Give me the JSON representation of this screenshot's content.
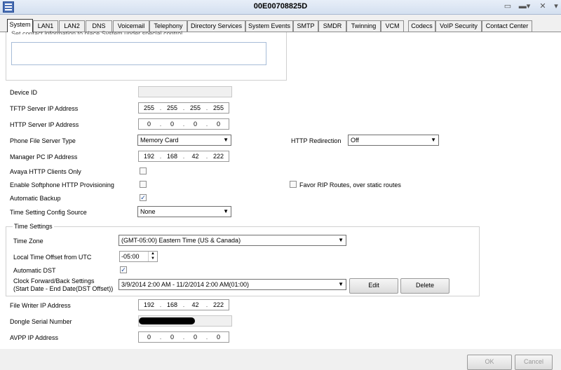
{
  "window": {
    "title": "00E00708825D"
  },
  "tabs": [
    {
      "label": "System"
    },
    {
      "label": "LAN1"
    },
    {
      "label": "LAN2"
    },
    {
      "label": "DNS"
    },
    {
      "label": "Voicemail"
    },
    {
      "label": "Telephony"
    },
    {
      "label": "Directory Services"
    },
    {
      "label": "System Events"
    },
    {
      "label": "SMTP"
    },
    {
      "label": "SMDR"
    },
    {
      "label": "Twinning"
    },
    {
      "label": "VCM"
    },
    {
      "label": "Codecs"
    },
    {
      "label": "VoIP Security"
    },
    {
      "label": "Contact Center"
    }
  ],
  "contact": {
    "partial_text": "Set contact information to place System under special control"
  },
  "fields": {
    "device_id": {
      "label": "Device ID",
      "value": ""
    },
    "tftp": {
      "label": "TFTP Server IP Address",
      "octets": [
        "255",
        "255",
        "255",
        "255"
      ]
    },
    "http_server": {
      "label": "HTTP Server IP Address",
      "octets": [
        "0",
        "0",
        "0",
        "0"
      ]
    },
    "phone_file_server": {
      "label": "Phone File Server Type",
      "value": "Memory Card"
    },
    "http_redirection": {
      "label": "HTTP Redirection",
      "value": "Off"
    },
    "manager_pc": {
      "label": "Manager PC IP Address",
      "octets": [
        "192",
        "168",
        "42",
        "222"
      ]
    },
    "avaya_http": {
      "label": "Avaya HTTP Clients Only"
    },
    "softphone_http": {
      "label": "Enable Softphone HTTP Provisioning"
    },
    "favor_rip": {
      "label": "Favor RIP Routes, over static routes"
    },
    "auto_backup": {
      "label": "Automatic Backup",
      "mark": "✓"
    },
    "time_source": {
      "label": "Time Setting Config Source",
      "value": "None"
    },
    "time_settings": {
      "legend": "Time Settings",
      "time_zone": {
        "label": "Time Zone",
        "value": "(GMT-05:00) Eastern Time (US & Canada)"
      },
      "offset": {
        "label": "Local Time Offset from UTC",
        "value": "-05:00"
      },
      "auto_dst": {
        "label": "Automatic DST",
        "mark": "✓"
      },
      "clock": {
        "label_line1": "Clock Forward/Back Settings",
        "label_line2": "(Start Date - End Date(DST Offset))",
        "value": "3/9/2014 2:00 AM - 11/2/2014 2:00 AM(01:00)",
        "edit": "Edit",
        "delete": "Delete"
      }
    },
    "file_writer": {
      "label": "File Writer IP Address",
      "octets": [
        "192",
        "168",
        "42",
        "222"
      ]
    },
    "dongle": {
      "label": "Dongle Serial Number"
    },
    "avpp": {
      "label": "AVPP IP Address",
      "octets": [
        "0",
        "0",
        "0",
        "0"
      ]
    }
  },
  "footer": {
    "ok": "OK",
    "cancel": "Cancel"
  },
  "colors": {
    "title_bar": "#d4e0f0",
    "active_tab_border": "#333333",
    "check_mark": "#2050a0"
  }
}
